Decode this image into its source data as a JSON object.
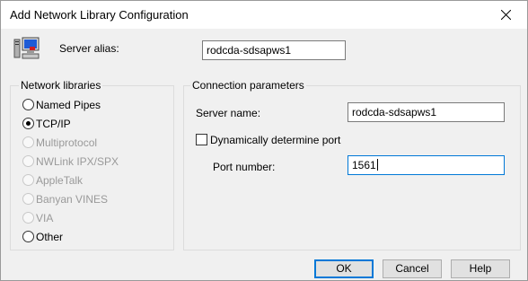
{
  "window": {
    "title": "Add Network Library Configuration"
  },
  "alias": {
    "label": "Server alias:",
    "value": "rodcda-sdsapws1"
  },
  "network_libraries": {
    "title": "Network libraries",
    "options": [
      {
        "label": "Named Pipes",
        "checked": false,
        "enabled": true
      },
      {
        "label": "TCP/IP",
        "checked": true,
        "enabled": true
      },
      {
        "label": "Multiprotocol",
        "checked": false,
        "enabled": false
      },
      {
        "label": "NWLink IPX/SPX",
        "checked": false,
        "enabled": false
      },
      {
        "label": "AppleTalk",
        "checked": false,
        "enabled": false
      },
      {
        "label": "Banyan VINES",
        "checked": false,
        "enabled": false
      },
      {
        "label": "VIA",
        "checked": false,
        "enabled": false
      },
      {
        "label": "Other",
        "checked": false,
        "enabled": true
      }
    ]
  },
  "connection": {
    "title": "Connection parameters",
    "server_name_label": "Server name:",
    "server_name_value": "rodcda-sdsapws1",
    "dynamic_port_label": "Dynamically determine port",
    "dynamic_port_checked": false,
    "port_label": "Port number:",
    "port_value": "1561"
  },
  "buttons": {
    "ok": "OK",
    "cancel": "Cancel",
    "help": "Help"
  },
  "colors": {
    "accent": "#0078d7",
    "dialog_bg": "#f0f0f0",
    "disabled_text": "#9a9a9a"
  }
}
